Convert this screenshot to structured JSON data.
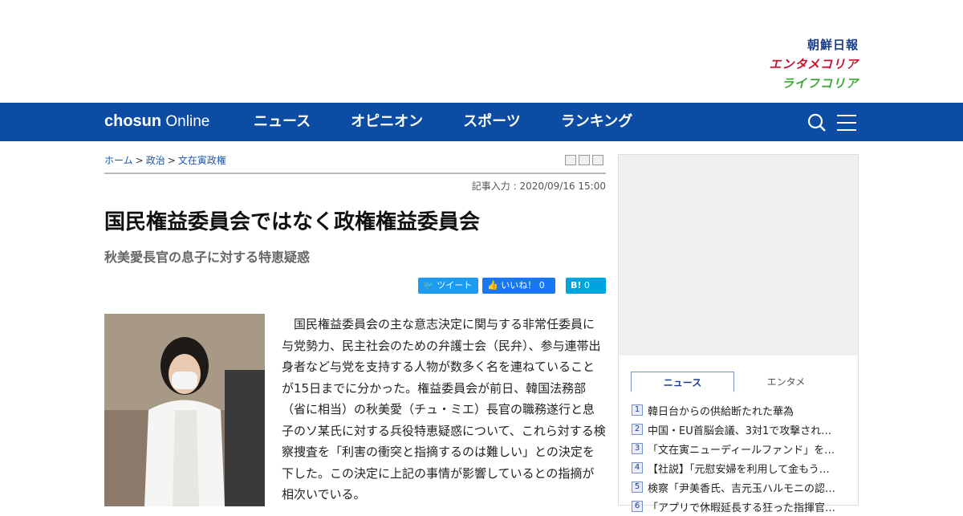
{
  "brands": {
    "chosun_ilbo": "朝鮮日報",
    "entame": "エンタメコリア",
    "life": "ライフコリア"
  },
  "nav": {
    "logo_bold": "chosun",
    "logo_light": "Online",
    "items": [
      "ニュース",
      "オピニオン",
      "スポーツ",
      "ランキング"
    ],
    "bg_color": "#0d4ca3"
  },
  "breadcrumb": {
    "home": "ホーム",
    "sep": ">",
    "cat": "政治",
    "sub": "文在寅政権"
  },
  "article": {
    "date": "記事入力 : 2020/09/16 15:00",
    "title": "国民権益委員会ではなく政権権益委員会",
    "subtitle": "秋美愛長官の息子に対する特恵疑惑",
    "body": "　国民権益委員会の主な意志決定に関与する非常任委員に与党勢力、民主社会のための弁護士会（民弁）、参与連帯出身者など与党を支持する人物が数多く名を連ねていることが15日までに分かった。権益委員会が前日、韓国法務部（省に相当）の秋美愛（チュ・ミエ）長官の職務遂行と息子のソ某氏に対する兵役特恵疑惑について、これら対する検察捜査を「利害の衝突と指摘するのは難しい」との決定を下した。この決定に上記の事情が影響しているとの指摘が相次いでいる。"
  },
  "share": {
    "tweet": "ツイート",
    "like": "いいね！",
    "like_count": "0",
    "hatena_count": "0"
  },
  "sidebar": {
    "tabs": [
      "ニュース",
      "エンタメ"
    ],
    "news": [
      {
        "n": "1",
        "t": "韓日台からの供給断たれた華為"
      },
      {
        "n": "2",
        "t": "中国・EU首脳会議、3対1で攻撃され…"
      },
      {
        "n": "3",
        "t": "「文在寅ニューディールファンド」を…"
      },
      {
        "n": "4",
        "t": "【社説】「元慰安婦を利用して金もう…"
      },
      {
        "n": "5",
        "t": "検察「尹美香氏、吉元玉ハルモニの認…"
      },
      {
        "n": "6",
        "t": "「アプリで休暇延長する狂った指揮官…"
      }
    ]
  }
}
